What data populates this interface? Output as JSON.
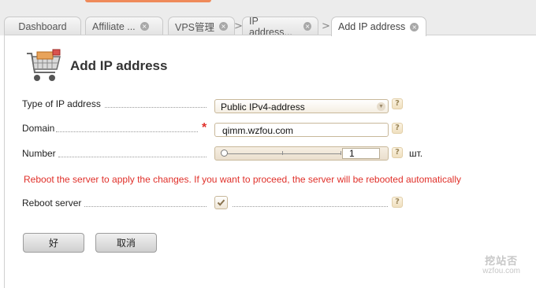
{
  "tabs": [
    {
      "label": "Dashboard",
      "closable": false,
      "active": false
    },
    {
      "label": "Affiliate ...",
      "closable": true,
      "active": false
    },
    {
      "label": "VPS管理",
      "closable": true,
      "active": false
    },
    {
      "label": "IP address...",
      "closable": true,
      "active": false
    },
    {
      "label": "Add IP address",
      "closable": true,
      "active": true
    }
  ],
  "tab_separator": ">",
  "tab_close_glyph": "×",
  "page": {
    "title": "Add IP address",
    "icon": "shopping-cart-icon"
  },
  "form": {
    "ip_type": {
      "label": "Type of IP address",
      "value": "Public IPv4-address"
    },
    "domain": {
      "label": "Domain",
      "value": "qimm.wzfou.com",
      "required_mark": "*"
    },
    "number": {
      "label": "Number",
      "value": "1",
      "unit": "шт.",
      "slider_position": 0
    },
    "warning": "Reboot the server to apply the changes. If you want to proceed, the server will be rebooted automatically",
    "reboot": {
      "label": "Reboot server",
      "checked": true
    },
    "help_glyph": "?",
    "select_arrow_glyph": "▼"
  },
  "buttons": {
    "ok": "好",
    "cancel": "取消"
  },
  "watermark": {
    "text": "挖站否",
    "url": "wzfou.com"
  },
  "colors": {
    "accent": "#ef8a5a",
    "error": "#e0302a",
    "tab_bar": "#ececec"
  }
}
